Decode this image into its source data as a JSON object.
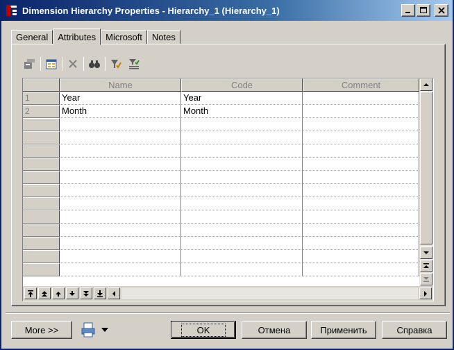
{
  "window": {
    "title": "Dimension Hierarchy Properties - Hierarchy_1 (Hierarchy_1)"
  },
  "tabs": [
    {
      "label": "General"
    },
    {
      "label": "Attributes"
    },
    {
      "label": "Microsoft"
    },
    {
      "label": "Notes"
    }
  ],
  "toolbar": [
    {
      "icon": "properties-icon"
    },
    {
      "icon": "add-attributes-icon"
    },
    {
      "icon": "delete-icon"
    },
    {
      "icon": "find-icon"
    },
    {
      "icon": "filter-icon"
    },
    {
      "icon": "filter-list-icon"
    }
  ],
  "grid": {
    "columns": [
      "Name",
      "Code",
      "Comment"
    ],
    "rows": [
      {
        "num": "1",
        "name": "Year",
        "code": "Year",
        "comment": ""
      },
      {
        "num": "2",
        "name": "Month",
        "code": "Month",
        "comment": ""
      }
    ],
    "empty_row_count": 12
  },
  "buttons": {
    "more": "More >>",
    "ok": "OK",
    "cancel": "Отмена",
    "apply": "Применить",
    "help": "Справка"
  },
  "colors": {
    "titlebar_start": "#0a246a",
    "titlebar_end": "#a6caf0",
    "face": "#d4d0c8"
  }
}
